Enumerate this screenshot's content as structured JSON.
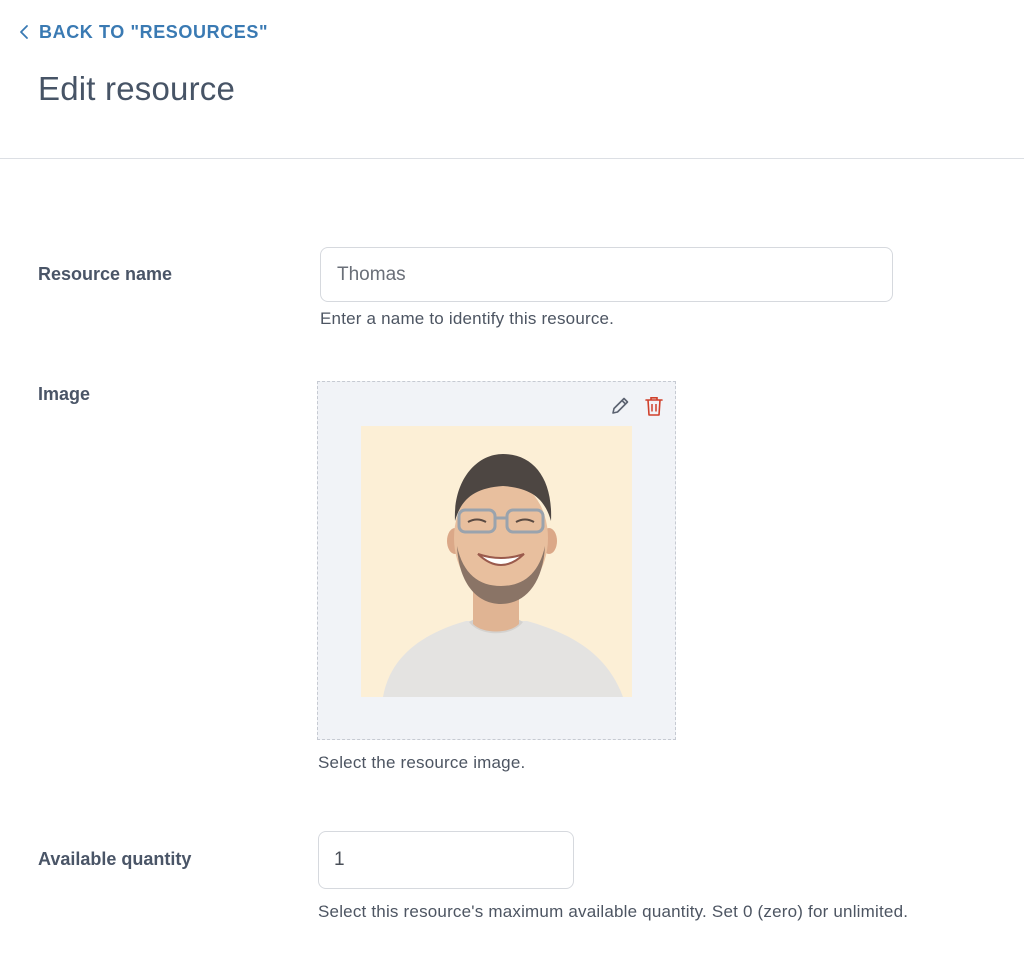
{
  "header": {
    "back_label": "BACK TO \"RESOURCES\"",
    "title": "Edit resource"
  },
  "form": {
    "name": {
      "label": "Resource name",
      "value": "Thomas",
      "help": "Enter a name to identify this resource."
    },
    "image": {
      "label": "Image",
      "help": "Select the resource image.",
      "edit_icon": "pencil-icon",
      "delete_icon": "trash-icon"
    },
    "quantity": {
      "label": "Available quantity",
      "value": "1",
      "help": "Select this resource's maximum available quantity. Set 0 (zero) for unlimited."
    }
  },
  "colors": {
    "link": "#3a7ab3",
    "delete": "#d0402b",
    "photo_bg": "#fcefd6"
  }
}
